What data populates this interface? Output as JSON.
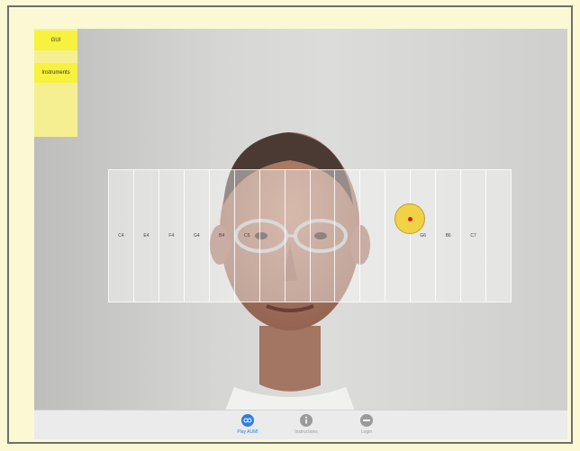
{
  "side_menu": {
    "gui_label": "GUI",
    "instruments_label": "Instruments"
  },
  "keyboard": {
    "keys": [
      "C4",
      "E4",
      "F4",
      "G4",
      "B4",
      "C5",
      "",
      "",
      "",
      "",
      "",
      "",
      "G6",
      "B6",
      "C7",
      ""
    ]
  },
  "tabs": {
    "play_label": "Play AUMI",
    "instructions_label": "Instructions",
    "login_label": "Login"
  },
  "colors": {
    "accent": "#2b7ee8",
    "cursor_fill": "#f1d247",
    "cursor_dot": "#d21d1d",
    "panel": "#f6ef92",
    "panel_button": "#f7f23d"
  },
  "icons": {
    "play": "play-aumi-icon",
    "instructions": "info-icon",
    "login": "login-icon"
  }
}
